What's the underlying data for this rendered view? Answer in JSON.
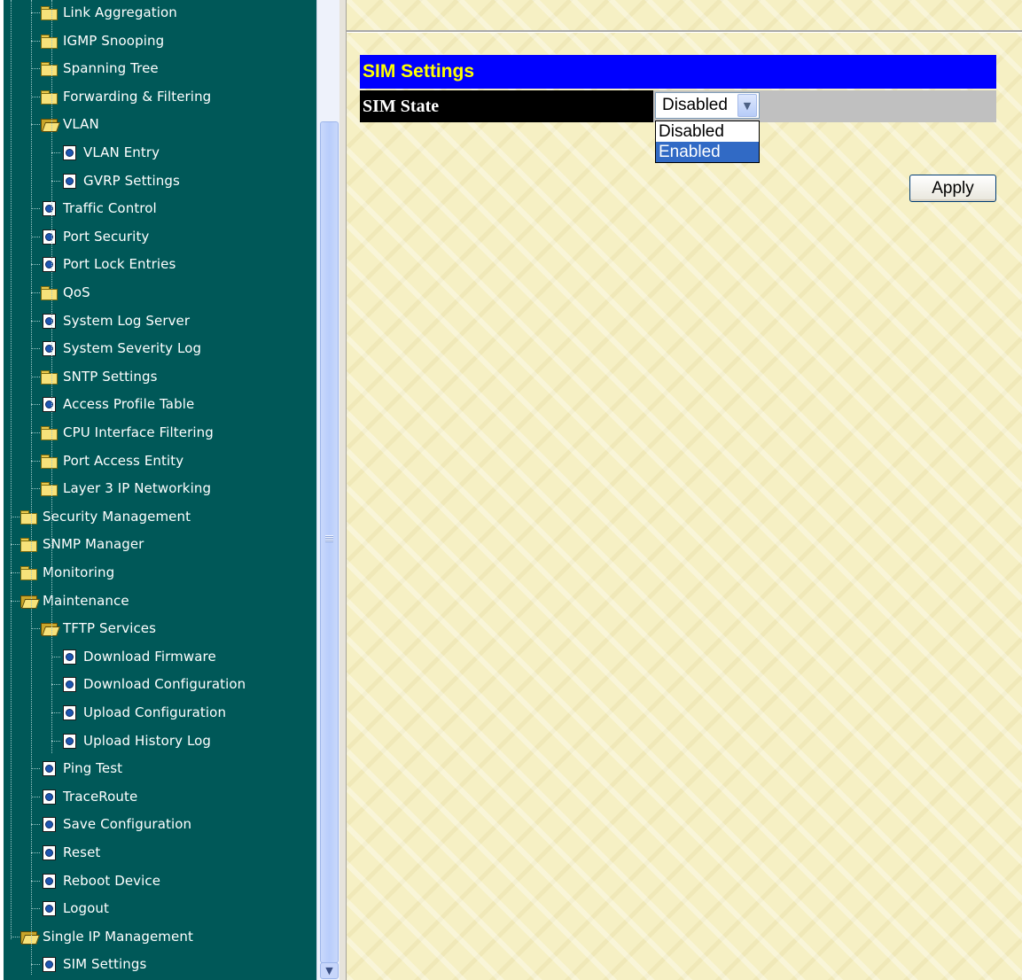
{
  "nav_tree": [
    {
      "label": "Link Aggregation",
      "icon": "folder-icon",
      "level": 1
    },
    {
      "label": "IGMP Snooping",
      "icon": "folder-icon",
      "level": 1
    },
    {
      "label": "Spanning Tree",
      "icon": "folder-icon",
      "level": 1
    },
    {
      "label": "Forwarding & Filtering",
      "icon": "folder-icon",
      "level": 1
    },
    {
      "label": "VLAN",
      "icon": "folder-open-icon",
      "level": 1
    },
    {
      "label": "VLAN Entry",
      "icon": "page-icon",
      "level": 2
    },
    {
      "label": "GVRP Settings",
      "icon": "page-icon",
      "level": 2
    },
    {
      "label": "Traffic Control",
      "icon": "page-icon",
      "level": 1
    },
    {
      "label": "Port Security",
      "icon": "page-icon",
      "level": 1
    },
    {
      "label": "Port Lock Entries",
      "icon": "page-icon",
      "level": 1
    },
    {
      "label": "QoS",
      "icon": "folder-icon",
      "level": 1
    },
    {
      "label": "System Log Server",
      "icon": "page-icon",
      "level": 1
    },
    {
      "label": "System Severity Log",
      "icon": "page-icon",
      "level": 1
    },
    {
      "label": "SNTP Settings",
      "icon": "folder-icon",
      "level": 1
    },
    {
      "label": "Access Profile Table",
      "icon": "page-icon",
      "level": 1
    },
    {
      "label": "CPU Interface Filtering",
      "icon": "folder-icon",
      "level": 1
    },
    {
      "label": "Port Access Entity",
      "icon": "folder-icon",
      "level": 1
    },
    {
      "label": "Layer 3 IP Networking",
      "icon": "folder-icon",
      "level": 1
    },
    {
      "label": "Security Management",
      "icon": "folder-icon",
      "level": 0
    },
    {
      "label": "SNMP Manager",
      "icon": "folder-icon",
      "level": 0
    },
    {
      "label": "Monitoring",
      "icon": "folder-icon",
      "level": 0
    },
    {
      "label": "Maintenance",
      "icon": "folder-open-icon",
      "level": 0
    },
    {
      "label": "TFTP Services",
      "icon": "folder-open-icon",
      "level": 1
    },
    {
      "label": "Download Firmware",
      "icon": "page-icon",
      "level": 2
    },
    {
      "label": "Download Configuration",
      "icon": "page-icon",
      "level": 2
    },
    {
      "label": "Upload Configuration",
      "icon": "page-icon",
      "level": 2
    },
    {
      "label": "Upload History Log",
      "icon": "page-icon",
      "level": 2
    },
    {
      "label": "Ping Test",
      "icon": "page-icon",
      "level": 1
    },
    {
      "label": "TraceRoute",
      "icon": "page-icon",
      "level": 1
    },
    {
      "label": "Save Configuration",
      "icon": "page-icon",
      "level": 1
    },
    {
      "label": "Reset",
      "icon": "page-icon",
      "level": 1
    },
    {
      "label": "Reboot Device",
      "icon": "page-icon",
      "level": 1
    },
    {
      "label": "Logout",
      "icon": "page-icon",
      "level": 1
    },
    {
      "label": "Single IP Management",
      "icon": "folder-open-icon",
      "level": 0
    },
    {
      "label": "SIM Settings",
      "icon": "page-icon",
      "level": 1
    }
  ],
  "main": {
    "title": "SIM Settings",
    "sim_state_label": "SIM State",
    "sim_state_value": "Disabled",
    "sim_state_options": [
      "Disabled",
      "Enabled"
    ],
    "highlighted_option": "Enabled",
    "apply_label": "Apply"
  },
  "colors": {
    "nav_background": "#005858",
    "title_bar": "#0000ff",
    "title_text": "#ffff00",
    "label_cell": "#000000",
    "value_cell": "#c0c0c0",
    "content_background": "#f6f0c4"
  }
}
